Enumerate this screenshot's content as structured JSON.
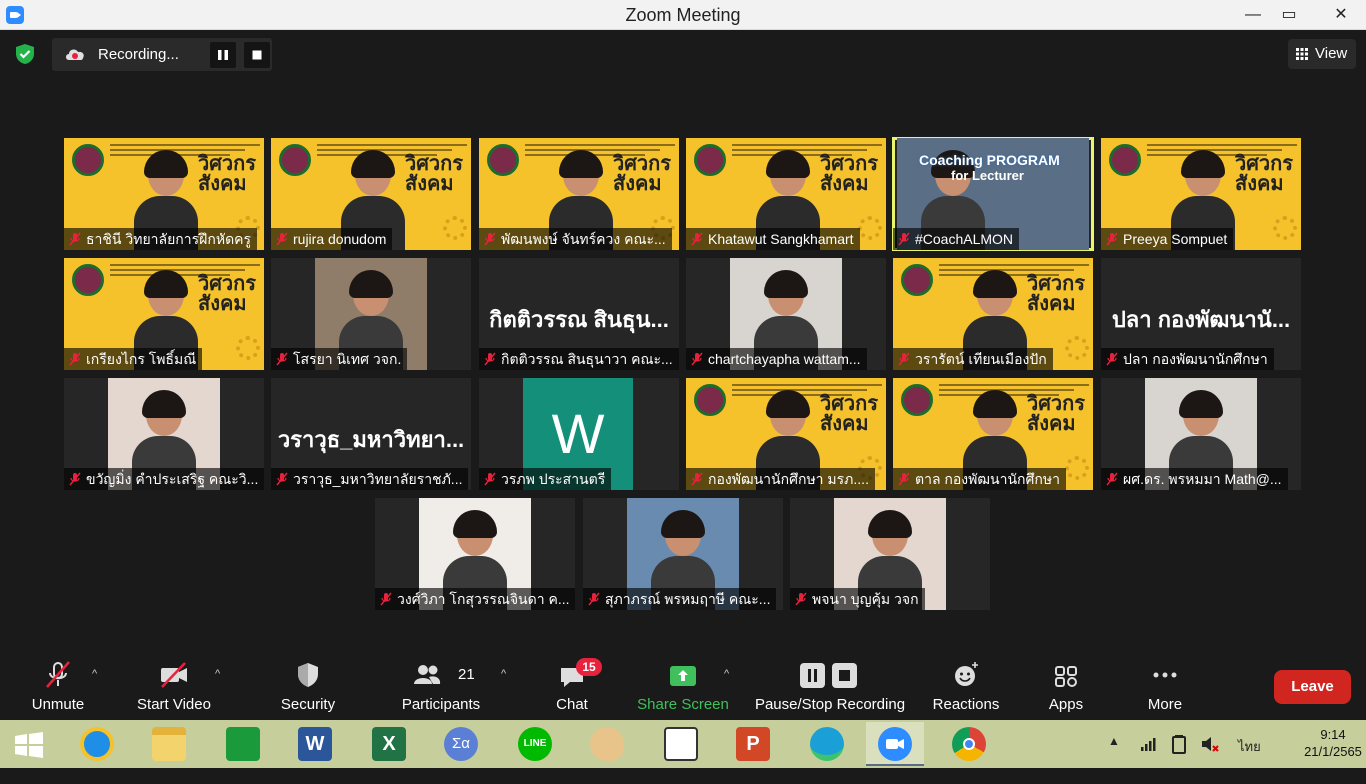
{
  "window": {
    "title": "Zoom Meeting",
    "controls": [
      "—",
      "▭",
      "✕"
    ]
  },
  "recording": {
    "label": "Recording..."
  },
  "view": {
    "label": "View"
  },
  "tiles": [
    {
      "name": "ธาชินี วิทยาลัยการฝึกหัดครู",
      "type": "banner",
      "active": false
    },
    {
      "name": "rujira donudom",
      "type": "banner",
      "active": false
    },
    {
      "name": "พัฒนพงษ์ จันทร์ควง คณะ...",
      "type": "banner",
      "active": false
    },
    {
      "name": "Khatawut Sangkhamart",
      "type": "banner",
      "active": false
    },
    {
      "name": "#CoachALMON",
      "type": "cam",
      "active": true,
      "overlay": "Coaching PROGRAM",
      "overlay2": "for Lecturer"
    },
    {
      "name": "Preeya Sompuet",
      "type": "banner",
      "active": false
    },
    {
      "name": "เกรียงไกร โพธิ์มณี",
      "type": "banner",
      "active": false
    },
    {
      "name": "โสรยา นิเทศ วจก.",
      "type": "cam",
      "active": false
    },
    {
      "name": "กิตติวรรณ สินธุนาวา คณะ...",
      "type": "text",
      "bigname": "กิตติวรรณ สินธุน...",
      "active": false
    },
    {
      "name": "chartchayapha wattam...",
      "type": "cam",
      "active": false
    },
    {
      "name": "วรารัตน์ เทียนเมืองปัก",
      "type": "banner",
      "active": false
    },
    {
      "name": "ปลา กองพัฒนานักศึกษา",
      "type": "text",
      "bigname": "ปลา กองพัฒนานั...",
      "active": false
    },
    {
      "name": "ขวัญมิ่ง คำประเสริฐ คณะวิ...",
      "type": "cam",
      "active": false
    },
    {
      "name": "วราวุธ_มหาวิทยาลัยราชภั...",
      "type": "text",
      "bigname": "วราวุธ_มหาวิทยา...",
      "active": false
    },
    {
      "name": "วรภพ ประสานตรี",
      "type": "avatar",
      "initial": "W",
      "active": false
    },
    {
      "name": "กองพัฒนานักศึกษา มรภ....",
      "type": "banner",
      "active": false
    },
    {
      "name": "ตาล กองพัฒนานักศึกษา",
      "type": "banner",
      "active": false
    },
    {
      "name": "ผศ.ดร. พรหมมา Math@...",
      "type": "cam",
      "active": false
    },
    {
      "name": "วงศ์วิภา โกสุวรรณจินดา ค...",
      "type": "cam",
      "active": false
    },
    {
      "name": "สุภาภรณ์ พรหมฤาษี คณะ...",
      "type": "cam",
      "active": false
    },
    {
      "name": "พจนา บุญคุ้ม วจก",
      "type": "cam",
      "active": false
    }
  ],
  "banner": {
    "brand_line1": "วิศวกร",
    "brand_line2": "สังคม"
  },
  "toolbar": {
    "unmute": "Unmute",
    "start_video": "Start Video",
    "security": "Security",
    "participants": "Participants",
    "participants_count": "21",
    "chat": "Chat",
    "chat_badge": "15",
    "share_screen": "Share Screen",
    "pause_stop": "Pause/Stop Recording",
    "reactions": "Reactions",
    "apps": "Apps",
    "more": "More",
    "leave": "Leave"
  },
  "taskbar": {
    "apps": [
      "windows-start",
      "internet-explorer",
      "file-explorer",
      "store",
      "word",
      "excel",
      "calculator",
      "line",
      "paint",
      "lisrel",
      "powerpoint",
      "edge",
      "zoom",
      "chrome"
    ],
    "lang": "ไทย",
    "time": "9:14",
    "date": "21/1/2565"
  },
  "colors": {
    "accent_green": "#3fc05c",
    "leave_red": "#d1261f",
    "badge_red": "#e8223d",
    "banner_yellow": "#f5c22b",
    "active_outline": "#e9f56a",
    "taskbar": "#c6cf9c"
  }
}
